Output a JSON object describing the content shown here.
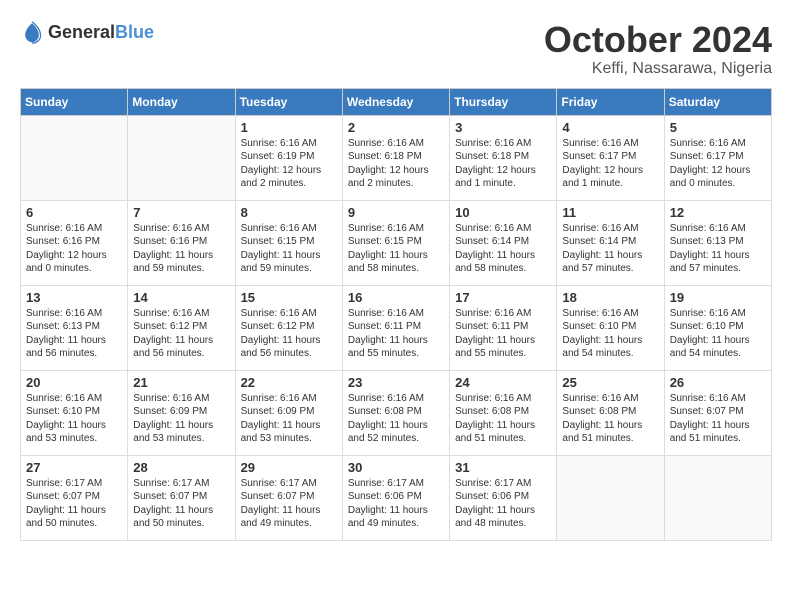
{
  "logo": {
    "general": "General",
    "blue": "Blue"
  },
  "title": "October 2024",
  "location": "Keffi, Nassarawa, Nigeria",
  "headers": [
    "Sunday",
    "Monday",
    "Tuesday",
    "Wednesday",
    "Thursday",
    "Friday",
    "Saturday"
  ],
  "weeks": [
    [
      {
        "day": "",
        "text": ""
      },
      {
        "day": "",
        "text": ""
      },
      {
        "day": "1",
        "text": "Sunrise: 6:16 AM\nSunset: 6:19 PM\nDaylight: 12 hours and 2 minutes."
      },
      {
        "day": "2",
        "text": "Sunrise: 6:16 AM\nSunset: 6:18 PM\nDaylight: 12 hours and 2 minutes."
      },
      {
        "day": "3",
        "text": "Sunrise: 6:16 AM\nSunset: 6:18 PM\nDaylight: 12 hours and 1 minute."
      },
      {
        "day": "4",
        "text": "Sunrise: 6:16 AM\nSunset: 6:17 PM\nDaylight: 12 hours and 1 minute."
      },
      {
        "day": "5",
        "text": "Sunrise: 6:16 AM\nSunset: 6:17 PM\nDaylight: 12 hours and 0 minutes."
      }
    ],
    [
      {
        "day": "6",
        "text": "Sunrise: 6:16 AM\nSunset: 6:16 PM\nDaylight: 12 hours and 0 minutes."
      },
      {
        "day": "7",
        "text": "Sunrise: 6:16 AM\nSunset: 6:16 PM\nDaylight: 11 hours and 59 minutes."
      },
      {
        "day": "8",
        "text": "Sunrise: 6:16 AM\nSunset: 6:15 PM\nDaylight: 11 hours and 59 minutes."
      },
      {
        "day": "9",
        "text": "Sunrise: 6:16 AM\nSunset: 6:15 PM\nDaylight: 11 hours and 58 minutes."
      },
      {
        "day": "10",
        "text": "Sunrise: 6:16 AM\nSunset: 6:14 PM\nDaylight: 11 hours and 58 minutes."
      },
      {
        "day": "11",
        "text": "Sunrise: 6:16 AM\nSunset: 6:14 PM\nDaylight: 11 hours and 57 minutes."
      },
      {
        "day": "12",
        "text": "Sunrise: 6:16 AM\nSunset: 6:13 PM\nDaylight: 11 hours and 57 minutes."
      }
    ],
    [
      {
        "day": "13",
        "text": "Sunrise: 6:16 AM\nSunset: 6:13 PM\nDaylight: 11 hours and 56 minutes."
      },
      {
        "day": "14",
        "text": "Sunrise: 6:16 AM\nSunset: 6:12 PM\nDaylight: 11 hours and 56 minutes."
      },
      {
        "day": "15",
        "text": "Sunrise: 6:16 AM\nSunset: 6:12 PM\nDaylight: 11 hours and 56 minutes."
      },
      {
        "day": "16",
        "text": "Sunrise: 6:16 AM\nSunset: 6:11 PM\nDaylight: 11 hours and 55 minutes."
      },
      {
        "day": "17",
        "text": "Sunrise: 6:16 AM\nSunset: 6:11 PM\nDaylight: 11 hours and 55 minutes."
      },
      {
        "day": "18",
        "text": "Sunrise: 6:16 AM\nSunset: 6:10 PM\nDaylight: 11 hours and 54 minutes."
      },
      {
        "day": "19",
        "text": "Sunrise: 6:16 AM\nSunset: 6:10 PM\nDaylight: 11 hours and 54 minutes."
      }
    ],
    [
      {
        "day": "20",
        "text": "Sunrise: 6:16 AM\nSunset: 6:10 PM\nDaylight: 11 hours and 53 minutes."
      },
      {
        "day": "21",
        "text": "Sunrise: 6:16 AM\nSunset: 6:09 PM\nDaylight: 11 hours and 53 minutes."
      },
      {
        "day": "22",
        "text": "Sunrise: 6:16 AM\nSunset: 6:09 PM\nDaylight: 11 hours and 53 minutes."
      },
      {
        "day": "23",
        "text": "Sunrise: 6:16 AM\nSunset: 6:08 PM\nDaylight: 11 hours and 52 minutes."
      },
      {
        "day": "24",
        "text": "Sunrise: 6:16 AM\nSunset: 6:08 PM\nDaylight: 11 hours and 51 minutes."
      },
      {
        "day": "25",
        "text": "Sunrise: 6:16 AM\nSunset: 6:08 PM\nDaylight: 11 hours and 51 minutes."
      },
      {
        "day": "26",
        "text": "Sunrise: 6:16 AM\nSunset: 6:07 PM\nDaylight: 11 hours and 51 minutes."
      }
    ],
    [
      {
        "day": "27",
        "text": "Sunrise: 6:17 AM\nSunset: 6:07 PM\nDaylight: 11 hours and 50 minutes."
      },
      {
        "day": "28",
        "text": "Sunrise: 6:17 AM\nSunset: 6:07 PM\nDaylight: 11 hours and 50 minutes."
      },
      {
        "day": "29",
        "text": "Sunrise: 6:17 AM\nSunset: 6:07 PM\nDaylight: 11 hours and 49 minutes."
      },
      {
        "day": "30",
        "text": "Sunrise: 6:17 AM\nSunset: 6:06 PM\nDaylight: 11 hours and 49 minutes."
      },
      {
        "day": "31",
        "text": "Sunrise: 6:17 AM\nSunset: 6:06 PM\nDaylight: 11 hours and 48 minutes."
      },
      {
        "day": "",
        "text": ""
      },
      {
        "day": "",
        "text": ""
      }
    ]
  ]
}
